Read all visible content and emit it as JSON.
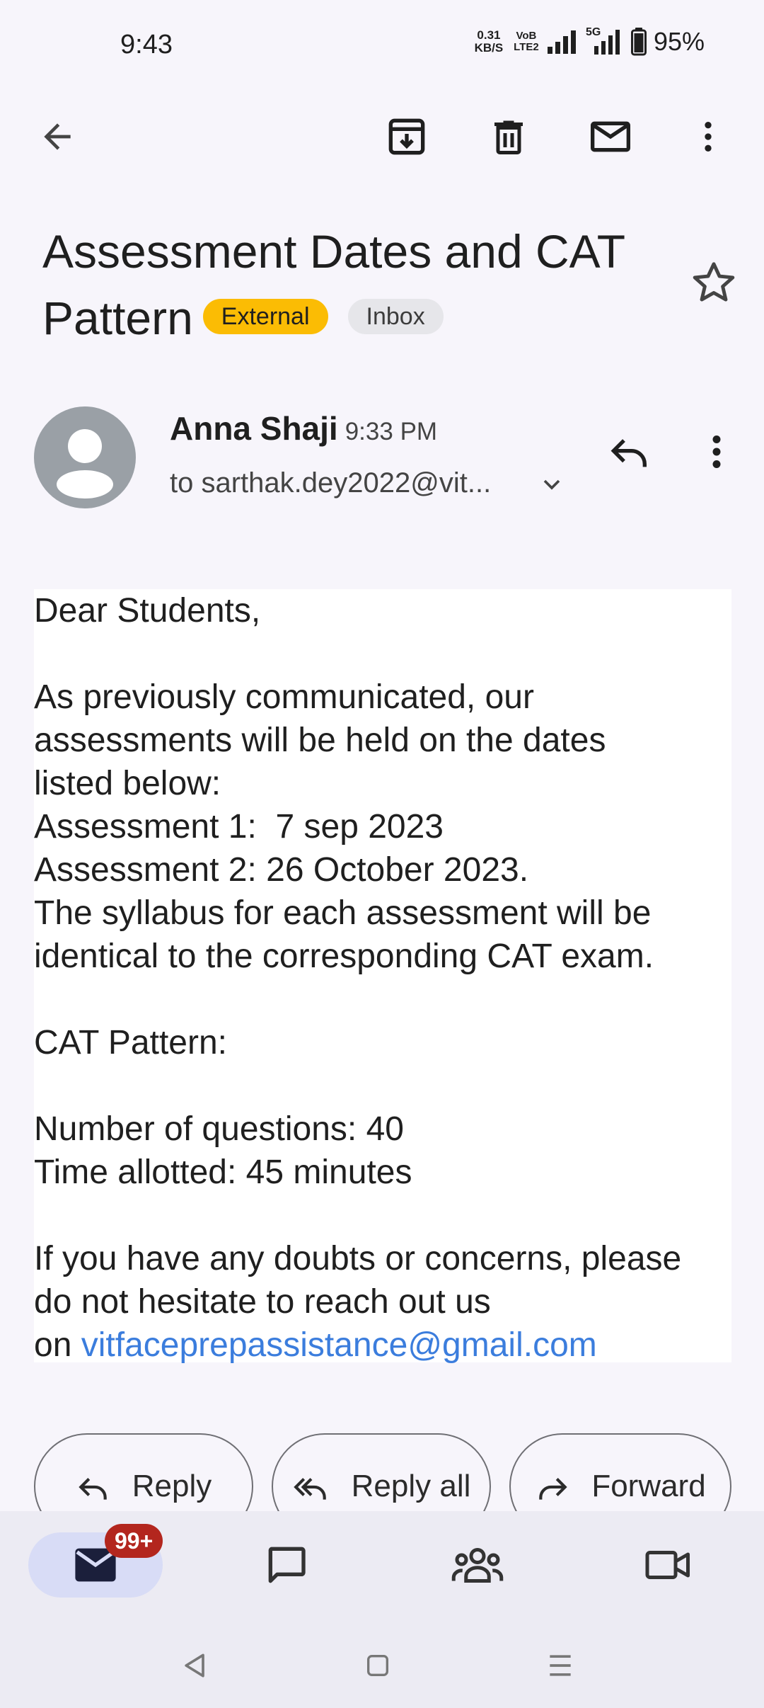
{
  "status_bar": {
    "time": "9:43",
    "net_speed_value": "0.31",
    "net_speed_unit": "KB/S",
    "volte_top": "VoB",
    "volte_bottom": "LTE2",
    "network_5g": "5G",
    "battery": "95%"
  },
  "toolbar": {
    "back_icon": "arrow-left",
    "archive_icon": "archive",
    "delete_icon": "trash",
    "unread_icon": "mail",
    "more_icon": "more-vertical"
  },
  "email": {
    "subject_line1": "Assessment Dates and CAT",
    "subject_line2": "Pattern",
    "label_external": "External",
    "label_inbox": "Inbox",
    "sender_name": "Anna Shaji",
    "sent_time": "9:33 PM",
    "recipient": "to sarthak.dey2022@vit...",
    "body_lines": [
      "Dear Students,",
      "",
      "As previously communicated, our",
      "assessments will be held on the dates",
      "listed below:",
      "Assessment 1:  7 sep 2023",
      "Assessment 2: 26 October 2023.",
      "The syllabus for each assessment will be",
      "identical to the corresponding CAT exam.",
      "",
      "CAT Pattern:",
      "",
      "Number of questions: 40",
      "Time allotted: 45 minutes",
      "",
      "If you have any doubts or concerns, please",
      "do not hesitate to reach out us"
    ],
    "last_line_prefix": "on ",
    "contact_email": "vitfaceprepassistance@gmail.com"
  },
  "actions": {
    "reply": "Reply",
    "reply_all": "Reply all",
    "forward": "Forward"
  },
  "bottom_nav": {
    "mail_badge": "99+",
    "items": [
      "mail-icon",
      "chat-icon",
      "spaces-icon",
      "meet-icon"
    ]
  },
  "colors": {
    "background": "#f7f5fb",
    "external_chip": "#fbbc04",
    "inbox_chip": "#e6e6ea",
    "link": "#3b7ddd",
    "nav_bg": "#ecebf3",
    "nav_active": "#d8dcf6",
    "badge": "#b3261e",
    "avatar": "#9aa0a6"
  }
}
